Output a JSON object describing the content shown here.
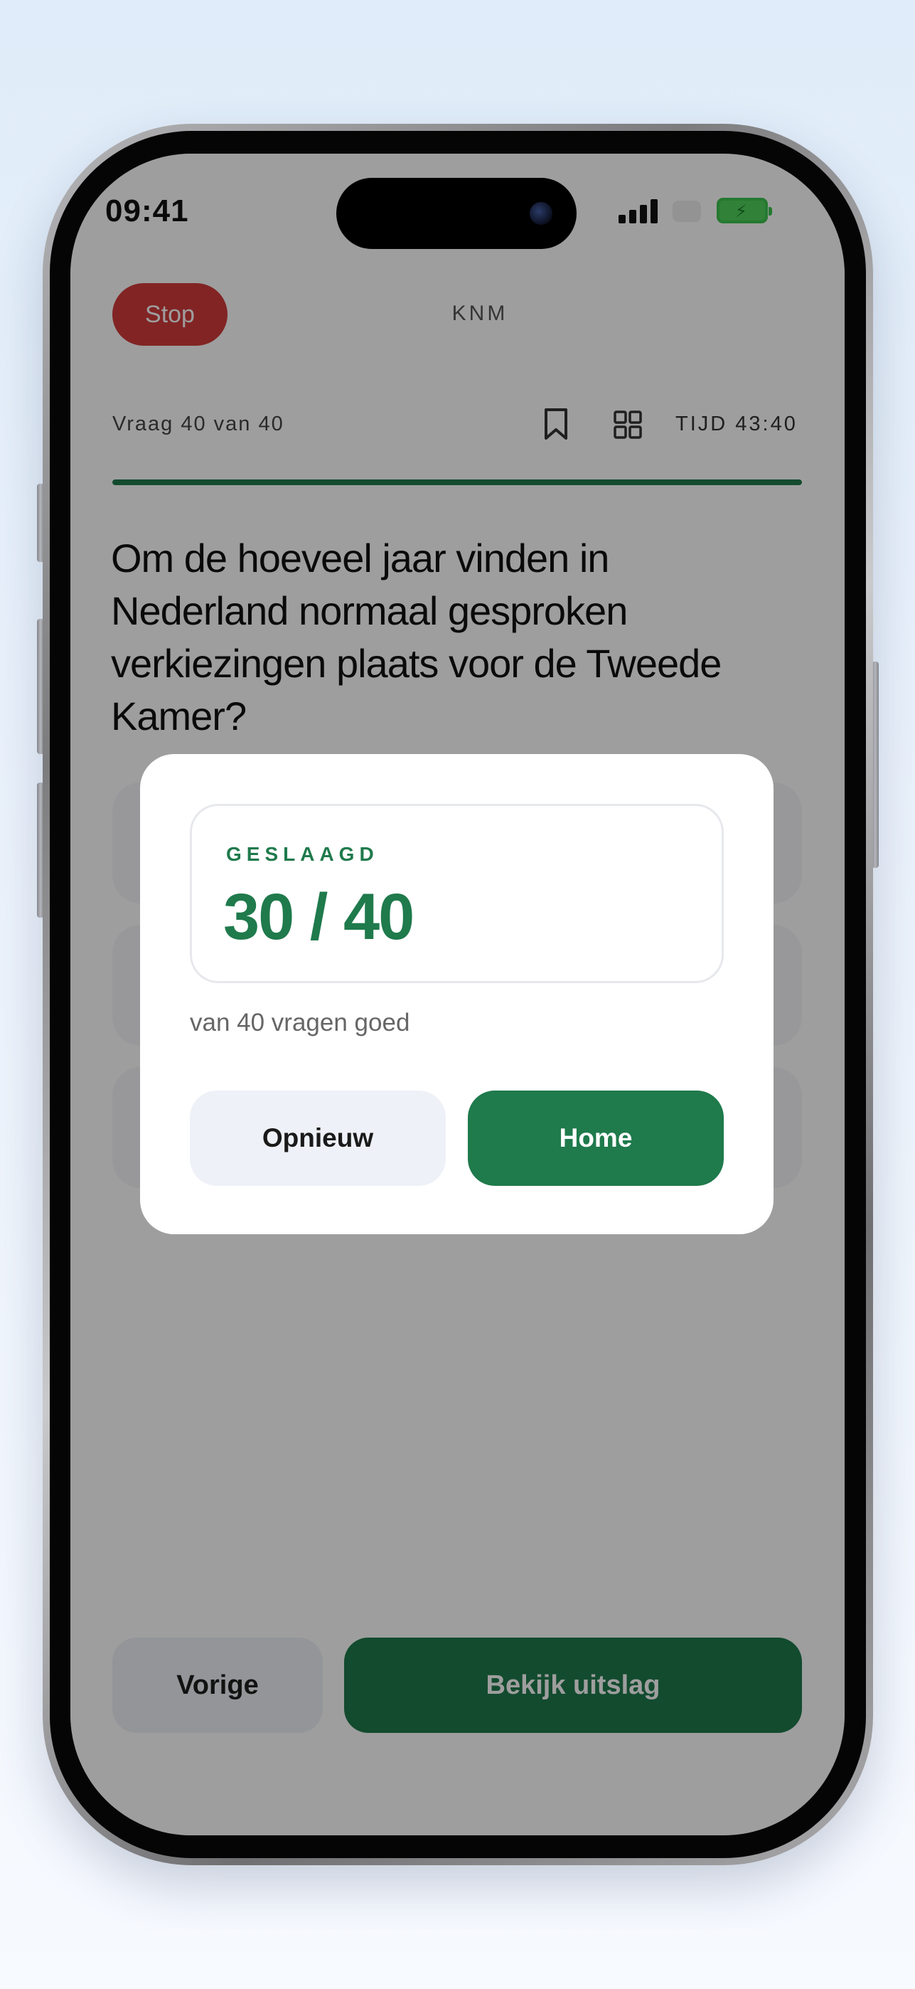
{
  "status_bar": {
    "time": "09:41",
    "battery_color": "#4fd15c"
  },
  "header": {
    "stop_label": "Stop",
    "app_title": "KNM",
    "question_counter": "Vraag 40 van 40",
    "timer": "TIJD 43:40",
    "icons": [
      "bookmark-icon",
      "grid-icon"
    ]
  },
  "progress": {
    "fraction": 1.0,
    "color": "#1f7a4c"
  },
  "question": {
    "text": "Om de hoeveel jaar vinden in Nederland normaal gesproken verkiezingen plaats voor de Tweede Kamer?"
  },
  "navigation": {
    "previous_label": "Vorige",
    "result_label": "Bekijk uitslag"
  },
  "result_modal": {
    "status_label": "GESLAAGD",
    "score": "30 / 40",
    "subtitle": "van 40 vragen goed",
    "retry_label": "Opnieuw",
    "home_label": "Home",
    "accent_color": "#1f7a4c"
  }
}
